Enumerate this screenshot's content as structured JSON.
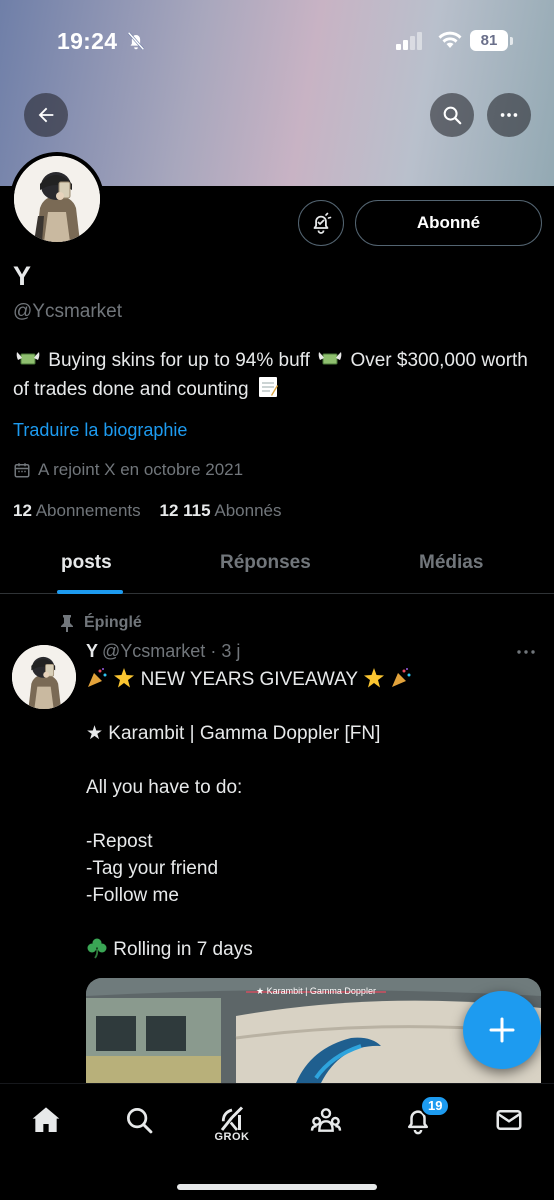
{
  "status_bar": {
    "time": "19:24",
    "battery": "81"
  },
  "profile": {
    "name": "Y",
    "handle": "@Ycsmarket",
    "follow_label": "Abonné",
    "bio_part1": "Buying skins for up to 94% buff",
    "bio_part2": "Over $300,000 worth of trades done and counting",
    "translate_label": "Traduire la biographie",
    "joined": "A rejoint X en octobre 2021",
    "following_count": "12",
    "following_label": "Abonnements",
    "followers_count": "12 115",
    "followers_label": "Abonnés"
  },
  "tabs": [
    {
      "label": "posts",
      "active": true
    },
    {
      "label": "Réponses",
      "active": false
    },
    {
      "label": "Médias",
      "active": false
    }
  ],
  "post": {
    "pinned_label": "Épinglé",
    "author_name": "Y",
    "author_handle": "@Ycsmarket",
    "time": "· 3 j",
    "title": "NEW YEARS GIVEAWAY",
    "item": "★ Karambit | Gamma Doppler [FN]",
    "instructions": "All you have to do:",
    "step1": "-Repost",
    "step2": "-Tag your friend",
    "step3": "-Follow me",
    "rolling": "Rolling in 7 days",
    "media_caption": "★ Karambit | Gamma Doppler"
  },
  "bottom_nav": {
    "grok_label": "GROK",
    "notification_badge": "19"
  },
  "colors": {
    "accent": "#1d9bf0",
    "text": "#e7e9ea",
    "muted": "#71767b",
    "background": "#000000"
  },
  "icons": [
    "bell-off-icon",
    "signal-icon",
    "wifi-icon",
    "battery-icon",
    "back-arrow-icon",
    "search-icon",
    "more-icon",
    "notification-bell-icon",
    "calendar-icon",
    "pin-icon",
    "plus-icon",
    "home-icon",
    "grok-icon",
    "communities-icon",
    "notifications-icon",
    "mail-icon"
  ]
}
